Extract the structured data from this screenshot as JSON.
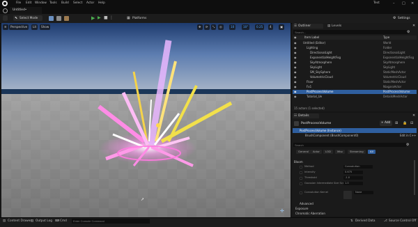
{
  "app": {
    "title": "Test",
    "doc_tab": "Untitled•"
  },
  "menu": [
    "File",
    "Edit",
    "Window",
    "Tools",
    "Build",
    "Select",
    "Actor",
    "Help"
  ],
  "toolbar": {
    "mode": "Select Mode",
    "platforms": "Platforms",
    "settings": "Settings"
  },
  "viewport": {
    "perspective": "Perspective",
    "lit": "Lit",
    "show": "Show",
    "grid_snap": "10",
    "rot_snap": "10°",
    "scale_snap": "0.25",
    "cam_speed": "4"
  },
  "outliner": {
    "tabs": [
      "Outliner",
      "Levels"
    ],
    "search_placeholder": "Search...",
    "col_label": "Item Label",
    "col_type": "Type",
    "rows": [
      {
        "label": "Untitled (Editor)",
        "type": "World",
        "indent": 1
      },
      {
        "label": "Lighting",
        "type": "Folder",
        "indent": 2
      },
      {
        "label": "DirectionalLight",
        "type": "DirectionalLight",
        "indent": 3
      },
      {
        "label": "ExponentialHeightFog",
        "type": "ExponentialHeightFog",
        "indent": 3
      },
      {
        "label": "SkyAtmosphere",
        "type": "SkyAtmosphere",
        "indent": 3
      },
      {
        "label": "SkyLight",
        "type": "SkyLight",
        "indent": 3
      },
      {
        "label": "SM_SkySphere",
        "type": "StaticMeshActor",
        "indent": 3
      },
      {
        "label": "VolumetricCloud",
        "type": "VolumetricCloud",
        "indent": 3
      },
      {
        "label": "Floor",
        "type": "StaticMeshActor",
        "indent": 2
      },
      {
        "label": "Fx1",
        "type": "NiagaraActor",
        "indent": 2
      },
      {
        "label": "PostProcessVolume",
        "type": "PostProcessVolume",
        "indent": 2
      },
      {
        "label": "Tutorial_Ue",
        "type": "DetailsMeshActor",
        "indent": 2
      }
    ],
    "selected_index": 10,
    "footer": "15 actors (1 selected)"
  },
  "details": {
    "tab": "Details",
    "actor": "PostProcessVolume",
    "add_label": "+ Add",
    "root": "PostProcessVolume (Instance)",
    "component": "BrushComponent (BrushComponent0)",
    "edit_link": "Edit in C++",
    "search_placeholder": "Search",
    "filter_tabs": [
      "General",
      "Actor",
      "LOD",
      "Misc",
      "Streaming",
      "All"
    ],
    "section_bloom": "Bloom",
    "props": [
      {
        "label": "Method",
        "value": "Convolution"
      },
      {
        "label": "Intensity",
        "value": "0.675"
      },
      {
        "label": "Threshold",
        "value": "-1.0"
      },
      {
        "label": "Gaussian Intermediate Size Scale",
        "value": "1.0"
      },
      {
        "label": "Convolution Kernel",
        "value": "None"
      }
    ],
    "section_advanced": "Advanced",
    "section_exposure": "Exposure",
    "section_chromatic": "Chromatic Aberration"
  },
  "statusbar": {
    "content_drawer": "Content Drawer",
    "output_log": "Output Log",
    "cmd": "Cmd",
    "cmd_placeholder": "Enter Console Command",
    "derived_data": "Derived Data",
    "source_control": "Source Control Off"
  },
  "colors": {
    "accent": "#2f5f9f",
    "play": "#4caf50",
    "ground": "#8f8f8f"
  }
}
